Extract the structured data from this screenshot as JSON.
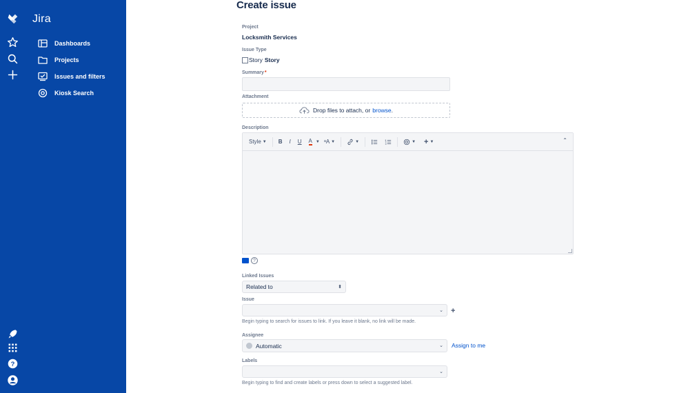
{
  "app": {
    "name": "Jira"
  },
  "nav": {
    "items": [
      {
        "label": "Dashboards",
        "icon": "dashboard-icon"
      },
      {
        "label": "Projects",
        "icon": "folder-icon"
      },
      {
        "label": "Issues and filters",
        "icon": "issues-icon"
      },
      {
        "label": "Kiosk Search",
        "icon": "target-icon"
      }
    ]
  },
  "form": {
    "title": "Create issue",
    "project": {
      "label": "Project",
      "value": "Locksmith Services"
    },
    "issue_type": {
      "label": "Issue Type",
      "alt_text": "Story",
      "value": "Story"
    },
    "summary": {
      "label": "Summary",
      "required_mark": "*",
      "value": ""
    },
    "attachment": {
      "label": "Attachment",
      "drop_text": "Drop files to attach, or",
      "browse_link": "browse",
      "period": "."
    },
    "description": {
      "label": "Description",
      "toolbar": {
        "style": "Style",
        "bold": "B",
        "italic": "I",
        "underline": "U",
        "text_color": "A",
        "more_text": "ᵃA",
        "plus": "+",
        "collapse": "⌃"
      }
    },
    "linked_issues": {
      "label": "Linked Issues",
      "selected": "Related to"
    },
    "issue": {
      "label": "Issue",
      "value": "",
      "hint": "Begin typing to search for issues to link. If you leave it blank, no link will be made."
    },
    "assignee": {
      "label": "Assignee",
      "selected": "Automatic",
      "assign_to_me": "Assign to me"
    },
    "labels": {
      "label": "Labels",
      "value": "",
      "hint": "Begin typing to find and create labels or press down to select a suggested label."
    }
  },
  "colors": {
    "sidebar": "#0747a6",
    "link": "#0052cc",
    "field_bg": "#f4f5f7",
    "required": "#de350b"
  }
}
